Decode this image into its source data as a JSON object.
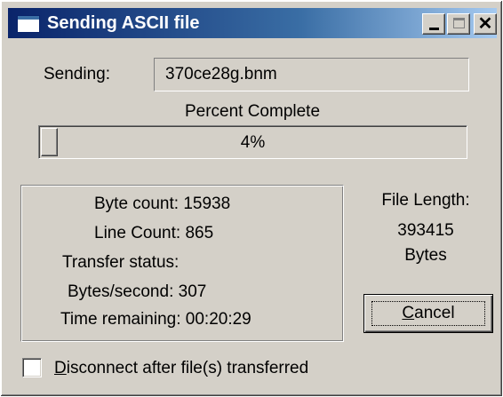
{
  "window": {
    "title": "Sending ASCII file",
    "controls": {
      "minimize": "_",
      "close": "✕"
    }
  },
  "sending": {
    "label": "Sending:",
    "filename": "370ce28g.bnm"
  },
  "progress": {
    "heading": "Percent Complete",
    "value_percent": 4,
    "text": "4%"
  },
  "stats": {
    "byte_count": "Byte count: 15938",
    "line_count": "Line Count: 865",
    "transfer_status": "Transfer status:",
    "bytes_per_second": "Bytes/second: 307",
    "time_remaining": "Time remaining: 00:20:29"
  },
  "file_length": {
    "label": "File Length:",
    "value": "393415",
    "unit": "Bytes"
  },
  "buttons": {
    "cancel": "Cancel"
  },
  "options": {
    "disconnect_label": "Disconnect after file(s) transferred",
    "disconnect_checked": false
  }
}
